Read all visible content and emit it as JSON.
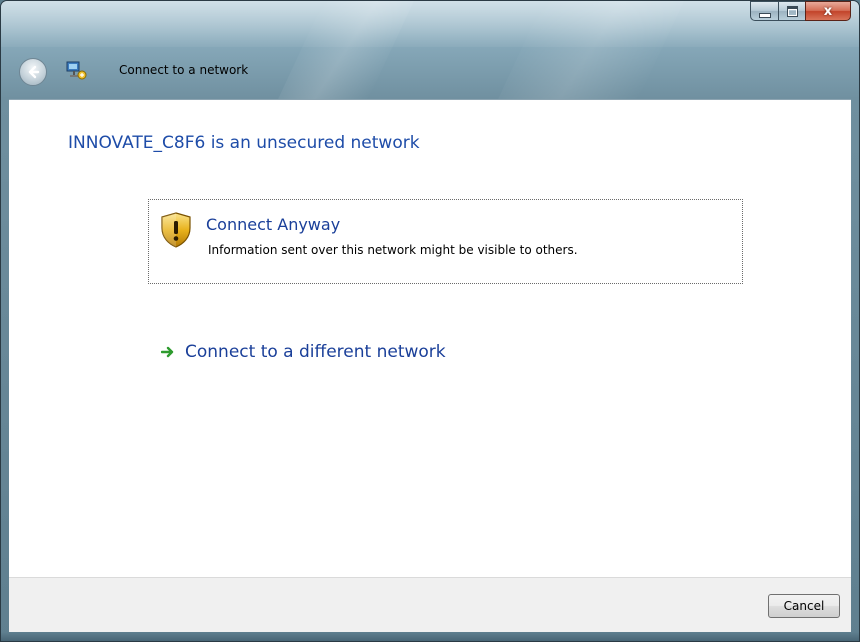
{
  "window": {
    "title": "Connect to a network",
    "close_label": "x"
  },
  "content": {
    "heading": "INNOVATE_C8F6 is an unsecured network",
    "connect_anyway": {
      "title": "Connect Anyway",
      "description": "Information sent over this network might be visible to others."
    },
    "different_network": {
      "label": "Connect to a different network"
    }
  },
  "footer": {
    "cancel_label": "Cancel"
  },
  "icons": {
    "back": "back-arrow-icon",
    "app": "network-icon",
    "shield": "security-shield-icon",
    "arrow": "green-arrow-icon"
  },
  "colors": {
    "link_blue": "#1a3f99",
    "heading_blue": "#1e4ca8",
    "arrow_green": "#2e9b2e",
    "shield_gold": "#e8b21c"
  }
}
